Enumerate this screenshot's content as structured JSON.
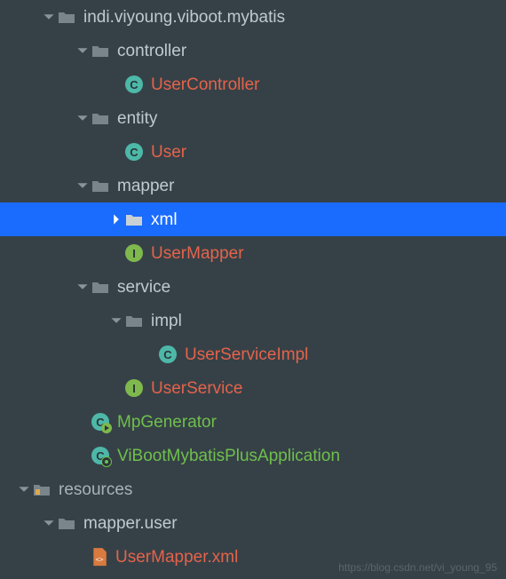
{
  "tree": {
    "root_package": "indi.viyoung.viboot.mybatis",
    "controller": {
      "label": "controller",
      "items": [
        "UserController"
      ]
    },
    "entity": {
      "label": "entity",
      "items": [
        "User"
      ]
    },
    "mapper": {
      "label": "mapper",
      "xml": "xml",
      "items": [
        "UserMapper"
      ]
    },
    "service": {
      "label": "service",
      "impl": {
        "label": "impl",
        "items": [
          "UserServiceImpl"
        ]
      },
      "items": [
        "UserService"
      ]
    },
    "classes": {
      "mp_generator": "MpGenerator",
      "app": "ViBootMybatisPlusApplication"
    },
    "resources": {
      "label": "resources",
      "mapper_user": {
        "label": "mapper.user",
        "items": [
          "UserMapper.xml"
        ]
      }
    }
  },
  "watermark": "https://blog.csdn.net/vi_young_95"
}
